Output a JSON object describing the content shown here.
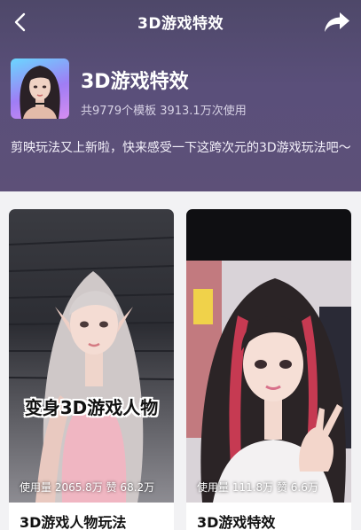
{
  "nav": {
    "title": "3D游戏特效"
  },
  "template_info": {
    "title": "3D游戏特效",
    "meta": "共9779个模板 3913.1万次使用",
    "description": "剪映玩法又上新啦，快来感受一下这跨次元的3D游戏玩法吧～"
  },
  "cards": [
    {
      "overlay_text": "变身3D游戏人物",
      "stats": "使用量 2065.8万 赞 68.2万",
      "title": "3D游戏人物玩法"
    },
    {
      "overlay_text": "",
      "stats": "使用量 111.8万 赞 6.6万",
      "title": "3D游戏特效"
    }
  ],
  "colors": {
    "hero_bg": "#5a4f7a",
    "page_bg": "#f2f2f4",
    "text_light": "#ffffff"
  }
}
